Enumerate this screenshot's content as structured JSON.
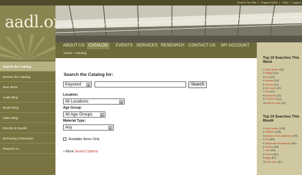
{
  "top_links": [
    "Search The Site",
    "Support AADL",
    "Help",
    "Logout"
  ],
  "logo": {
    "main": "aadl",
    "suffix": ".org"
  },
  "sidebar": {
    "items": [
      {
        "label": "Search the Catalog",
        "active": true
      },
      {
        "label": "Browse the Catalog"
      },
      {
        "label": "New Items"
      },
      {
        "label": "Audio Blog"
      },
      {
        "label": "Books Blog"
      },
      {
        "label": "Video Blog"
      },
      {
        "label": "Ebooks & Eaudio"
      },
      {
        "label": "Borrowing Information"
      },
      {
        "label": "Request ILL"
      }
    ]
  },
  "menu": {
    "items": [
      {
        "label": "ABOUT US"
      },
      {
        "label": "CATALOG",
        "active": true
      },
      {
        "label": "EVENTS"
      },
      {
        "label": "SERVICES"
      },
      {
        "label": "RESEARCH"
      },
      {
        "label": "CONTACT US"
      },
      {
        "label": "MY ACCOUNT"
      }
    ]
  },
  "breadcrumb": "Home » Catalog",
  "search": {
    "heading": "Search the Catalog for:",
    "type_value": "Keyword:",
    "button_label": "Search",
    "location_label": "Location:",
    "location_value": "All Locations",
    "age_label": "Age Group:",
    "age_value": "All Age Groups",
    "material_label": "Material Type:",
    "material_value": "Any",
    "available_label": "Available Items Only",
    "more_prefix": "» More",
    "more_link": "Search Options"
  },
  "top_week": {
    "heading": "Top 10 Searches This Week",
    "items": [
      {
        "n": "1",
        "term": "harry potter",
        "count": "(23)"
      },
      {
        "n": "2",
        "term": "twilight",
        "count": "(19)"
      },
      {
        "n": "3",
        "term": "lost",
        "count": "(15)"
      },
      {
        "n": "4",
        "term": "cheese",
        "count": "(14)"
      },
      {
        "n": "5",
        "term": "heroes",
        "count": "(14)"
      },
      {
        "n": "6",
        "term": "star wars",
        "count": "(13)"
      },
      {
        "n": "7",
        "term": "lost",
        "count": "(13)"
      },
      {
        "n": "8",
        "term": "sopranos",
        "count": "(13)"
      },
      {
        "n": "9",
        "term": "FLIGHTS",
        "count": "(12)"
      },
      {
        "n": "10",
        "term": "gilmore girls",
        "count": "(11)"
      }
    ]
  },
  "top_month": {
    "heading": "Top 10 Searches This Month",
    "items": [
      {
        "n": "1",
        "term": "harry potter",
        "count": "(128)"
      },
      {
        "n": "2",
        "term": "children",
        "count": "(128)"
      },
      {
        "n": "3",
        "term": "pirates of the caribbean",
        "count": "(99)"
      },
      {
        "n": "4",
        "term": "lost",
        "count": "(85)"
      },
      {
        "n": "5",
        "term": "desperate housewives",
        "count": "(69)"
      },
      {
        "n": "6",
        "term": "eclipse",
        "count": "(66)"
      },
      {
        "n": "7",
        "term": "vaio",
        "count": "(63)"
      },
      {
        "n": "8",
        "term": "heroes",
        "count": "(61)"
      },
      {
        "n": "9",
        "term": "gaga",
        "count": "(57)"
      },
      {
        "n": "10",
        "term": "star wars",
        "count": "(57)"
      }
    ]
  },
  "colors": {
    "sidebar": "#7a7442",
    "menubar": "#6d6a3a",
    "right_panel": "#cfc8a1",
    "link": "#c0392b"
  }
}
